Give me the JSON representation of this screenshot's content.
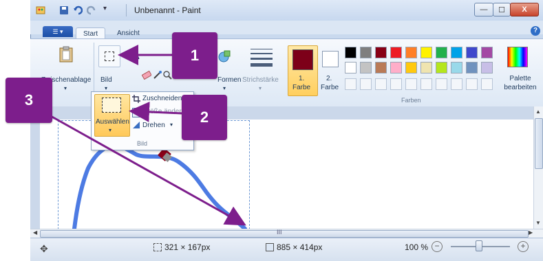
{
  "window": {
    "title": "Unbenannt - Paint",
    "minimize_glyph": "—",
    "maximize_glyph": "☐",
    "close_glyph": "X"
  },
  "tabs": [
    {
      "label": "Start",
      "active": true
    },
    {
      "label": "Ansicht",
      "active": false
    }
  ],
  "help_glyph": "?",
  "ribbon": {
    "clipboard_label": "Zwischenablage",
    "image_label": "Bild",
    "shapes_label": "Formen",
    "stroke_label": "Strichstärke",
    "color1_label_line1": "1.",
    "color1_label_line2": "Farbe",
    "color2_label_line1": "2.",
    "color2_label_line2": "Farbe",
    "edit_palette_line1": "Palette",
    "edit_palette_line2": "bearbeiten",
    "colors_group_title": "Farben",
    "color1_value": "#7d0019",
    "color2_value": "#ffffff",
    "palette_row1": [
      "#000000",
      "#7f7f7f",
      "#880015",
      "#ed1c24",
      "#ff7f27",
      "#fff200",
      "#22b14c",
      "#00a2e8",
      "#3f48cc",
      "#a349a4"
    ],
    "palette_row2": [
      "#ffffff",
      "#c3c3c3",
      "#b97a57",
      "#ffaec9",
      "#ffc90e",
      "#efe4b0",
      "#b5e61d",
      "#99d9ea",
      "#7092be",
      "#c8bfe7"
    ]
  },
  "dropdown": {
    "select_label": "Auswählen",
    "crop_label": "Zuschneiden",
    "resize_label": "Größe ändern",
    "rotate_label": "Drehen",
    "group_title": "Bild"
  },
  "scroll": {
    "thumb_glyph": "III"
  },
  "status": {
    "selection_size": "321 × 167px",
    "image_size": "885 × 414px",
    "zoom": "100 %"
  },
  "callouts": [
    "1",
    "2",
    "3"
  ],
  "accent_color": "#7d1e8c"
}
